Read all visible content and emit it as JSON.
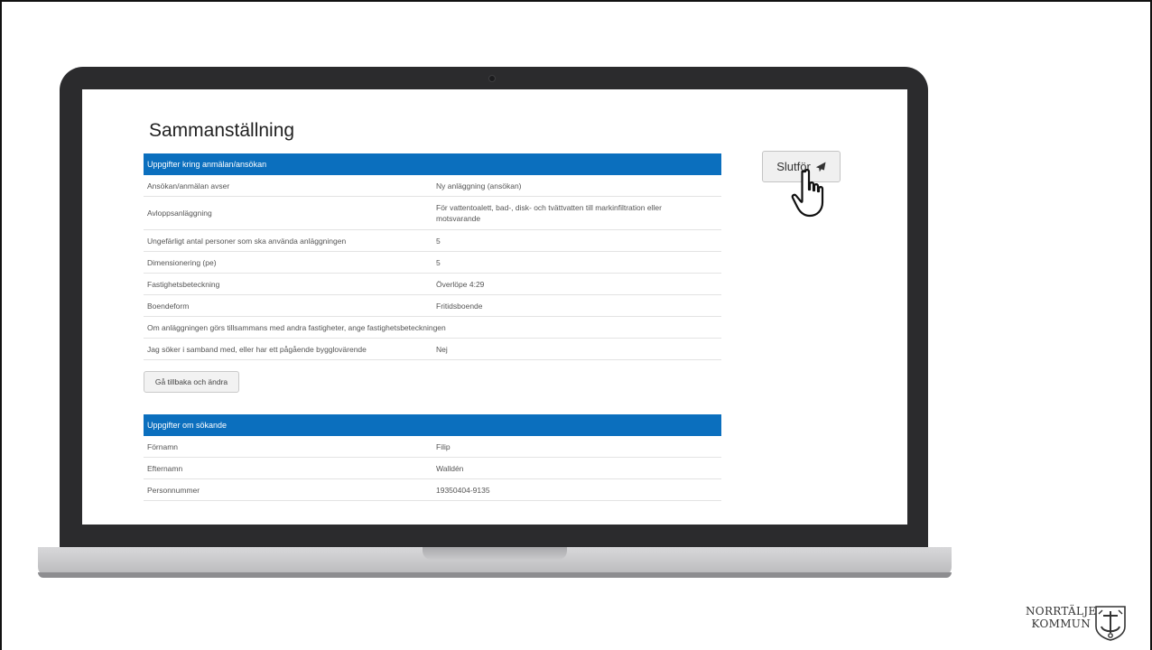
{
  "page": {
    "title": "Sammanställning"
  },
  "section_application": {
    "header": "Uppgifter kring anmälan/ansökan",
    "rows": [
      {
        "label": "Ansökan/anmälan avser",
        "value": "Ny anläggning (ansökan)"
      },
      {
        "label": "Avloppsanläggning",
        "value": "För vattentoalett, bad-, disk- och tvättvatten till markinfiltration eller motsvarande"
      },
      {
        "label": "Ungefärligt antal personer som ska använda anläggningen",
        "value": "5"
      },
      {
        "label": "Dimensionering (pe)",
        "value": "5"
      },
      {
        "label": "Fastighetsbeteckning",
        "value": "Överlöpe 4:29"
      },
      {
        "label": "Boendeform",
        "value": "Fritidsboende"
      },
      {
        "label": "Om anläggningen görs tillsammans med andra fastigheter, ange fastighetsbeteckningen",
        "value": ""
      },
      {
        "label": "Jag söker i samband med, eller har ett pågående bygglovärende",
        "value": "Nej"
      }
    ],
    "back_button": "Gå tillbaka och ändra"
  },
  "section_applicant": {
    "header": "Uppgifter om sökande",
    "rows": [
      {
        "label": "Förnamn",
        "value": "Filip"
      },
      {
        "label": "Efternamn",
        "value": "Walldén"
      },
      {
        "label": "Personnummer",
        "value": "19350404-9135"
      }
    ]
  },
  "actions": {
    "finish_label": "Slutför",
    "finish_icon": "paper-plane-icon",
    "cursor_icon": "hand-pointer-icon"
  },
  "logo": {
    "line1": "NORRTÄLJE",
    "line2": "KOMMUN"
  },
  "colors": {
    "header_blue": "#0b6fbe",
    "laptop_bezel": "#2b2b2d"
  }
}
